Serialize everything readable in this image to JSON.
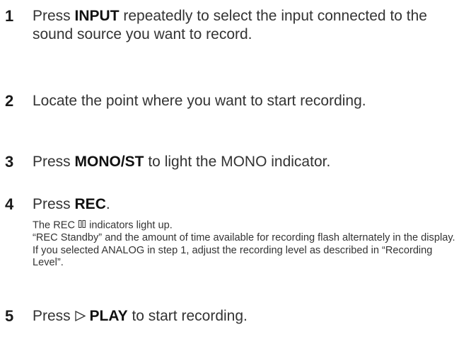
{
  "steps": [
    {
      "number": "1",
      "text_before": "Press ",
      "bold": "INPUT",
      "text_after": " repeatedly to select the input connected to the sound source you want to record."
    },
    {
      "number": "2",
      "text": "Locate the point where you want to start recording."
    },
    {
      "number": "3",
      "text_before": "Press ",
      "bold": "MONO/ST",
      "text_after": " to light the MONO indicator."
    },
    {
      "number": "4",
      "text_before": "Press ",
      "bold": "REC",
      "text_after": ".",
      "notes": {
        "line1_before": "The REC ",
        "line1_after": " indicators light up.",
        "line2": "“REC Standby” and the amount of time available for recording flash alternately in the display.",
        "line3": "If you selected ANALOG in step 1, adjust the recording level as described in “Recording Level”."
      }
    },
    {
      "number": "5",
      "text_before": "Press ",
      "icon": "play-icon",
      "bold": "PLAY",
      "text_after": " to start recording."
    }
  ]
}
